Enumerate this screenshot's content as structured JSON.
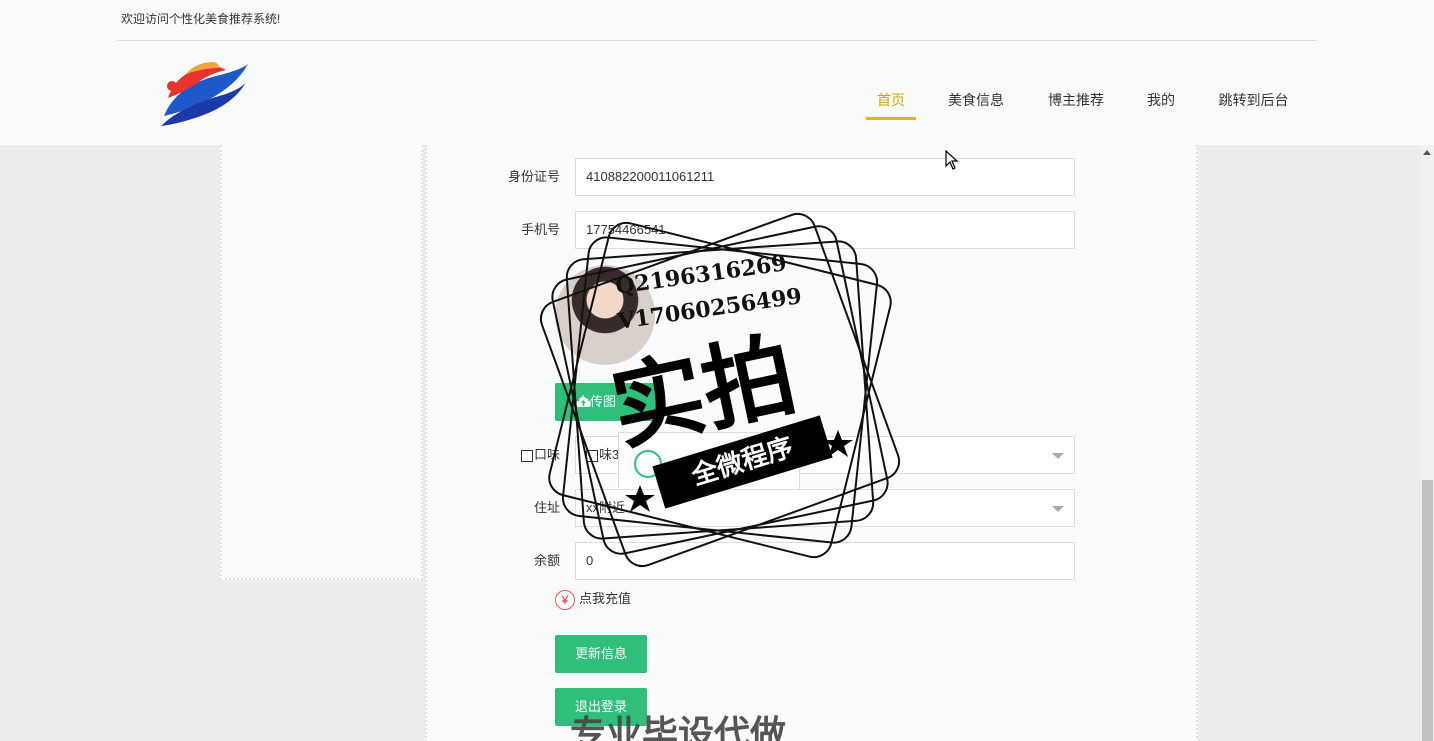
{
  "header": {
    "welcome": "欢迎访问个性化美食推荐系统!"
  },
  "nav": {
    "items": [
      {
        "label": "首页",
        "active": true
      },
      {
        "label": "美食信息",
        "active": false
      },
      {
        "label": "博主推荐",
        "active": false
      },
      {
        "label": "我的",
        "active": false
      },
      {
        "label": "跳转到后台",
        "active": false
      }
    ]
  },
  "form": {
    "id_label": "身份证号",
    "id_value": "410882200011061211",
    "phone_label": "手机号",
    "phone_value": "17754466541",
    "upload_label": "上传图",
    "taste_label": "口味",
    "taste_option": "味3",
    "address_label": "住址",
    "address_value": "xx附近",
    "balance_label": "余额",
    "balance_value": "0",
    "recharge_icon": "¥",
    "recharge_label": "点我充值",
    "update_button": "更新信息",
    "logout_button": "退出登录"
  },
  "watermark": {
    "qq": "Q2196316269",
    "wechat": "V17060256499",
    "big_text": "实拍",
    "banner": "全微程序",
    "bottom": "专业毕设代做"
  },
  "colors": {
    "accent": "#2fbf7b",
    "nav_active": "#d4a20c"
  }
}
